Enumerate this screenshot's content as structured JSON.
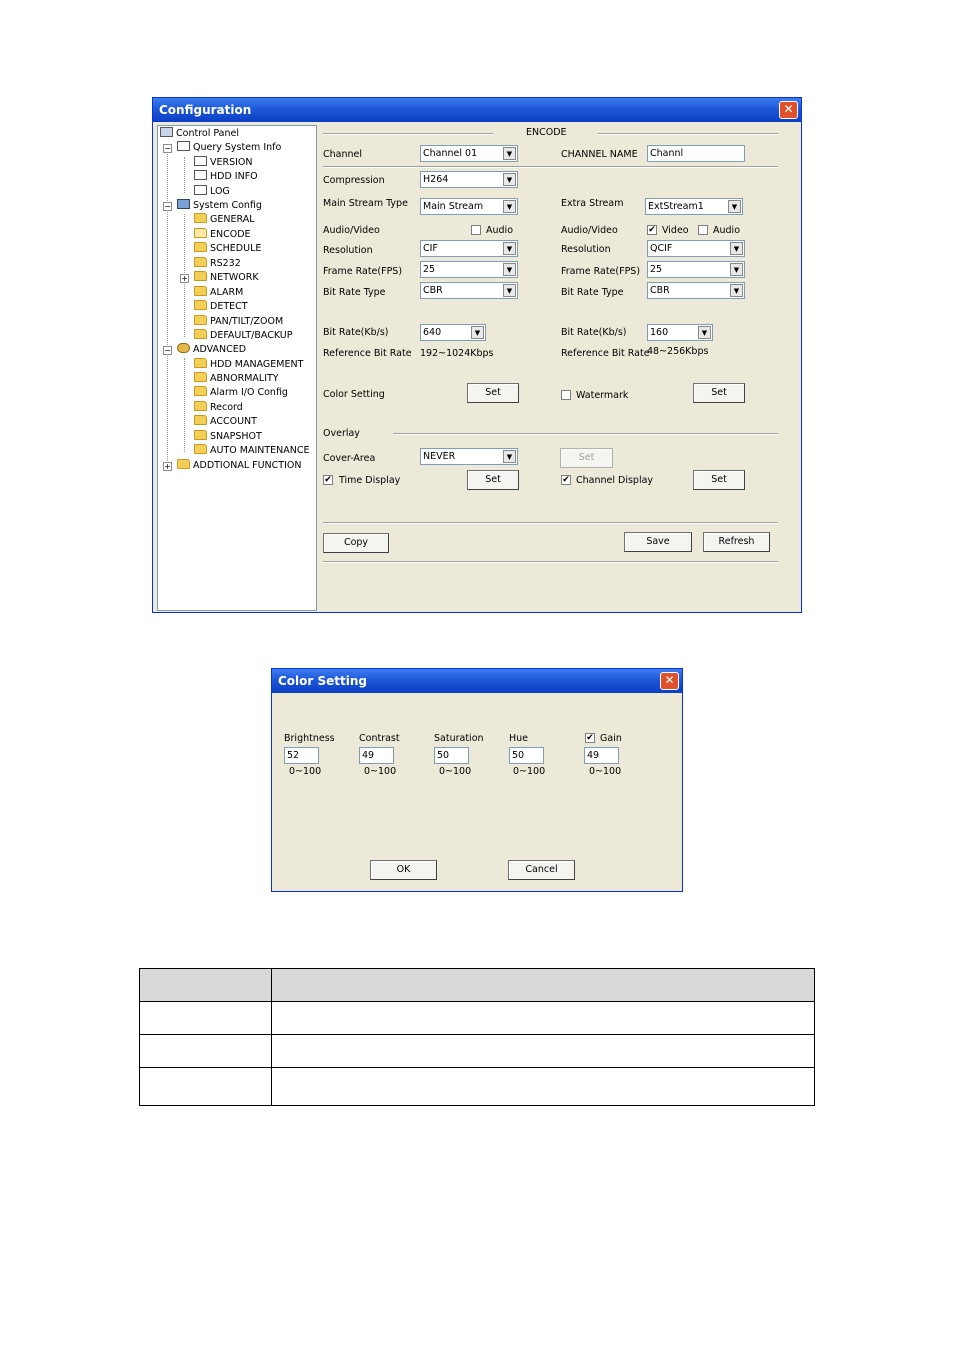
{
  "config_window": {
    "title": "Configuration",
    "tree": {
      "root": "Control Panel",
      "items": [
        {
          "label": "Query System Info"
        },
        {
          "label": "VERSION"
        },
        {
          "label": "HDD INFO"
        },
        {
          "label": "LOG"
        },
        {
          "label": "System Config"
        },
        {
          "label": "GENERAL"
        },
        {
          "label": "ENCODE"
        },
        {
          "label": "SCHEDULE"
        },
        {
          "label": "RS232"
        },
        {
          "label": "NETWORK"
        },
        {
          "label": "ALARM"
        },
        {
          "label": "DETECT"
        },
        {
          "label": "PAN/TILT/ZOOM"
        },
        {
          "label": "DEFAULT/BACKUP"
        },
        {
          "label": "ADVANCED"
        },
        {
          "label": "HDD MANAGEMENT"
        },
        {
          "label": "ABNORMALITY"
        },
        {
          "label": "Alarm I/O Config"
        },
        {
          "label": "Record"
        },
        {
          "label": "ACCOUNT"
        },
        {
          "label": "SNAPSHOT"
        },
        {
          "label": "AUTO MAINTENANCE"
        },
        {
          "label": "ADDTIONAL FUNCTION"
        }
      ]
    },
    "encode": {
      "section_title": "ENCODE",
      "channel_label": "Channel",
      "channel_value": "Channel 01",
      "channel_name_label": "CHANNEL NAME",
      "channel_name_value": "Channl",
      "compression_label": "Compression",
      "compression_value": "H264",
      "main_stream_type_label": "Main Stream Type",
      "main_stream_type_value": "Main Stream",
      "extra_stream_label": "Extra Stream",
      "extra_stream_value": "ExtStream1",
      "audio_video_label": "Audio/Video",
      "audio_label": "Audio",
      "video_label": "Video",
      "main": {
        "audio_checked": false,
        "resolution_label": "Resolution",
        "resolution_value": "CIF",
        "frame_rate_label": "Frame Rate(FPS)",
        "frame_rate_value": "25",
        "bit_rate_type_label": "Bit Rate Type",
        "bit_rate_type_value": "CBR",
        "bit_rate_label": "Bit Rate(Kb/s)",
        "bit_rate_value": "640",
        "reference_label": "Reference Bit Rate",
        "reference_value": "192~1024Kbps"
      },
      "extra": {
        "video_checked": true,
        "audio_checked": false,
        "resolution_label": "Resolution",
        "resolution_value": "QCIF",
        "frame_rate_label": "Frame Rate(FPS)",
        "frame_rate_value": "25",
        "bit_rate_type_label": "Bit Rate Type",
        "bit_rate_type_value": "CBR",
        "bit_rate_label": "Bit Rate(Kb/s)",
        "bit_rate_value": "160",
        "reference_label": "Reference Bit Rate",
        "reference_value": "48~256Kbps"
      },
      "color_setting_label": "Color Setting",
      "watermark_label": "Watermark",
      "watermark_checked": false,
      "set_label": "Set",
      "overlay_label": "Overlay",
      "cover_area_label": "Cover-Area",
      "cover_area_value": "NEVER",
      "time_display_label": "Time Display",
      "time_display_checked": true,
      "channel_display_label": "Channel Display",
      "channel_display_checked": true,
      "copy_label": "Copy",
      "save_label": "Save",
      "refresh_label": "Refresh"
    }
  },
  "color_window": {
    "title": "Color Setting",
    "fields": [
      {
        "label": "Brightness",
        "value": "52",
        "range": "0~100"
      },
      {
        "label": "Contrast",
        "value": "49",
        "range": "0~100"
      },
      {
        "label": "Saturation",
        "value": "50",
        "range": "0~100"
      },
      {
        "label": "Hue",
        "value": "50",
        "range": "0~100"
      },
      {
        "label": "Gain",
        "value": "49",
        "range": "0~100",
        "checked": true
      }
    ],
    "ok_label": "OK",
    "cancel_label": "Cancel"
  },
  "table": {
    "rows": 4
  }
}
